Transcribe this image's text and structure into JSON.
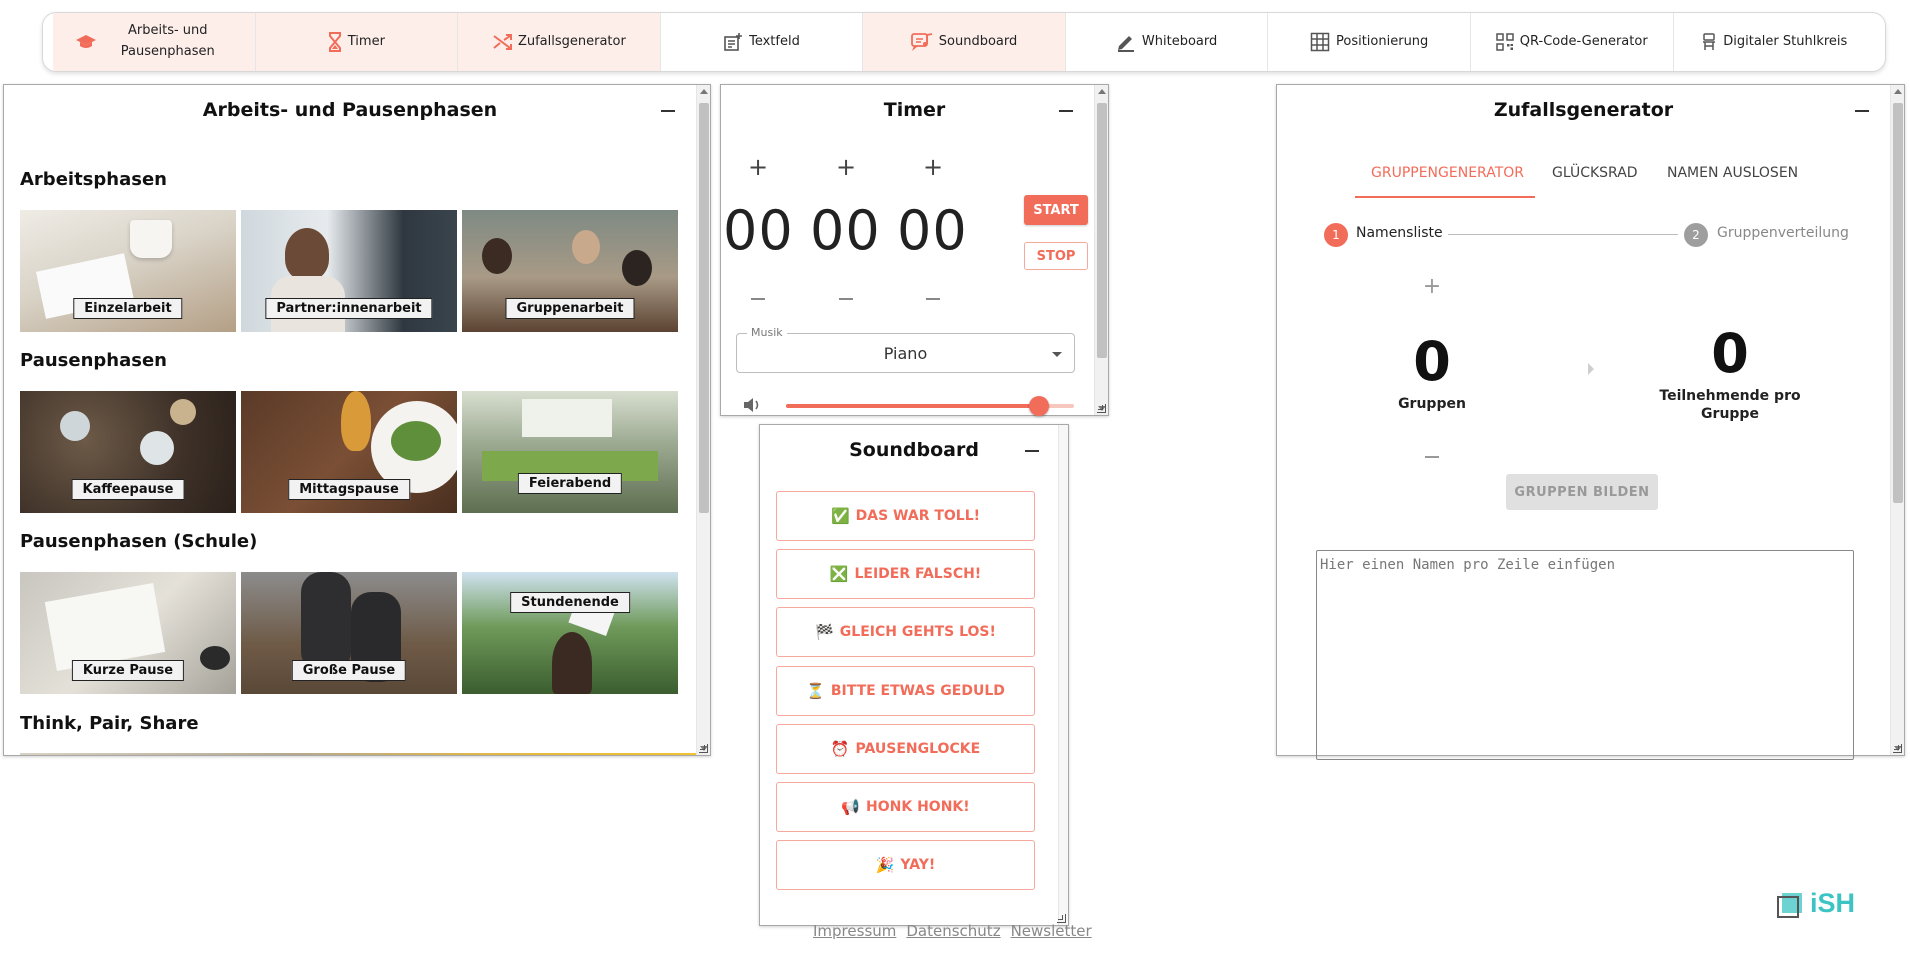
{
  "nav": [
    {
      "label": "Arbeits- und Pausenphasen",
      "icon": "graduation-cap-icon",
      "active": true
    },
    {
      "label": "Timer",
      "icon": "hourglass-icon",
      "active": true
    },
    {
      "label": "Zufallsgenerator",
      "icon": "shuffle-icon",
      "active": true
    },
    {
      "label": "Textfeld",
      "icon": "text-box-icon",
      "active": false
    },
    {
      "label": "Soundboard",
      "icon": "music-note-icon",
      "active": true
    },
    {
      "label": "Whiteboard",
      "icon": "pencil-icon",
      "active": false
    },
    {
      "label": "Positionierung",
      "icon": "grid-icon",
      "active": false
    },
    {
      "label": "QR-Code-Generator",
      "icon": "qr-code-icon",
      "active": false
    },
    {
      "label": "Digitaler Stuhlkreis",
      "icon": "chair-icon",
      "active": false
    }
  ],
  "phasen": {
    "title": "Arbeits- und Pausenphasen",
    "sections": [
      {
        "title": "Arbeitsphasen",
        "tiles": [
          "Einzelarbeit",
          "Partner:innenarbeit",
          "Gruppenarbeit"
        ]
      },
      {
        "title": "Pausenphasen",
        "tiles": [
          "Kaffeepause",
          "Mittagspause",
          "Feierabend"
        ]
      },
      {
        "title": "Pausenphasen (Schule)",
        "tiles": [
          "Kurze Pause",
          "Große Pause",
          "Stundenende"
        ]
      },
      {
        "title": "Think, Pair, Share",
        "tiles": []
      }
    ]
  },
  "timer": {
    "title": "Timer",
    "hours": "00",
    "minutes": "00",
    "seconds": "00",
    "start_label": "START",
    "stop_label": "STOP",
    "music_label": "Musik",
    "music_value": "Piano",
    "volume": 0.88
  },
  "soundboard": {
    "title": "Soundboard",
    "buttons": [
      {
        "emoji": "✅",
        "label": "DAS WAR TOLL!"
      },
      {
        "emoji": "❎",
        "label": "LEIDER FALSCH!"
      },
      {
        "emoji": "🏁",
        "label": "GLEICH GEHTS LOS!"
      },
      {
        "emoji": "⏳",
        "label": "BITTE ETWAS GEDULD"
      },
      {
        "emoji": "⏰",
        "label": "PAUSENGLOCKE"
      },
      {
        "emoji": "📢",
        "label": "HONK HONK!"
      },
      {
        "emoji": "🎉",
        "label": "YAY!"
      }
    ]
  },
  "zufall": {
    "title": "Zufallsgenerator",
    "tabs": [
      "GRUPPENGENERATOR",
      "GLÜCKSRAD",
      "NAMEN AUSLOSEN"
    ],
    "steps": [
      {
        "num": "1",
        "label": "Namensliste"
      },
      {
        "num": "2",
        "label": "Gruppenverteilung"
      }
    ],
    "groups_value": "0",
    "groups_label": "Gruppen",
    "per_group_value": "0",
    "per_group_label": "Teilnehmende pro Gruppe",
    "build_label": "GRUPPEN BILDEN",
    "textarea_placeholder": "Hier einen Namen pro Zeile einfügen"
  },
  "footer": {
    "links": [
      "Impressum",
      "Datenschutz",
      "Newsletter"
    ]
  },
  "logo": {
    "text": "iSH"
  },
  "colors": {
    "accent": "#f26c5a",
    "active_nav": "#fdeeea",
    "logo": "#3cc3c3"
  }
}
